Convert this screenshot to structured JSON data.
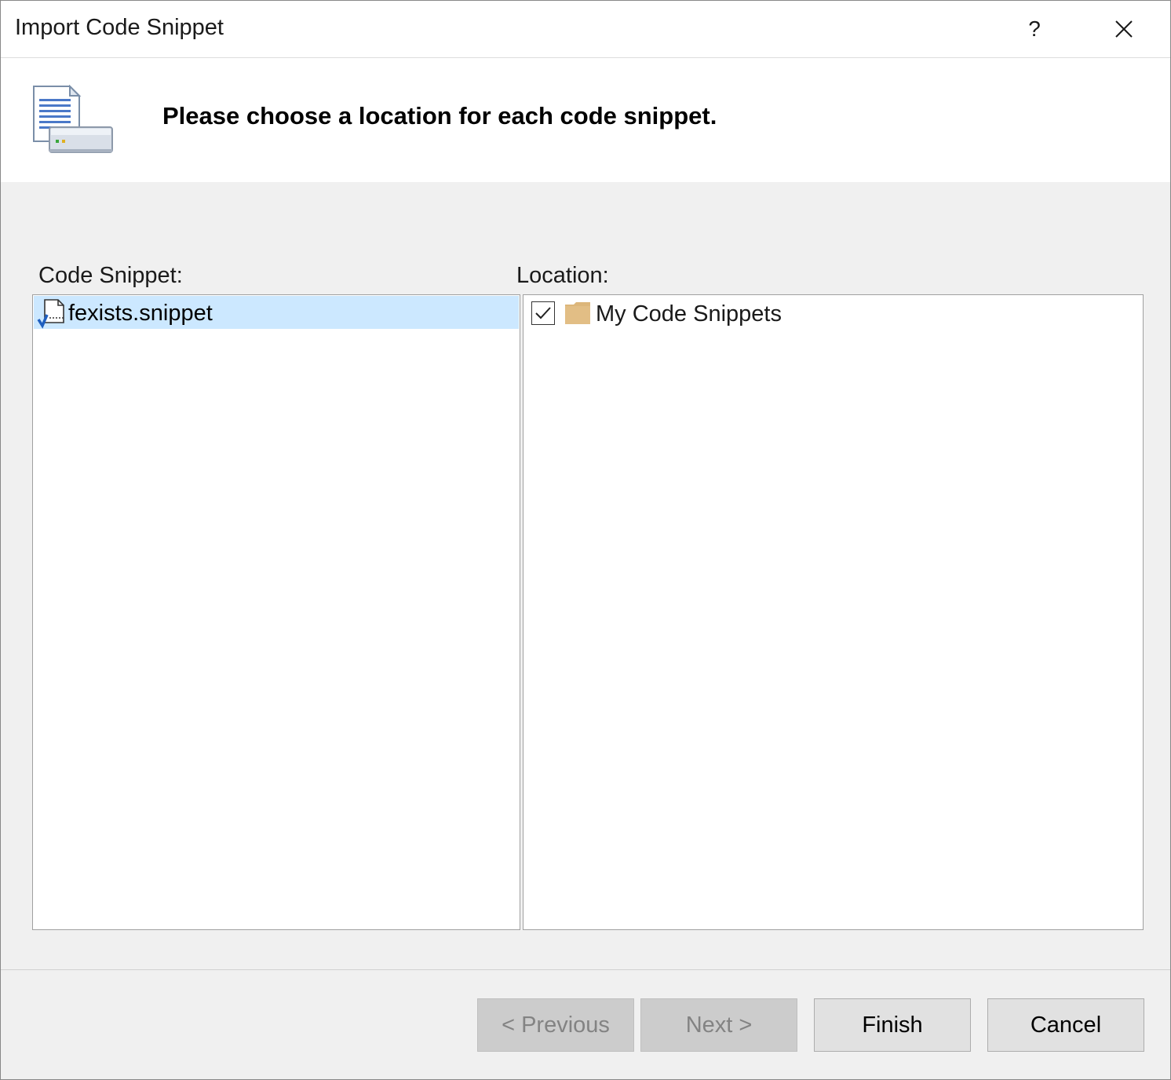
{
  "window": {
    "title": "Import Code Snippet",
    "help_label": "?"
  },
  "banner": {
    "heading": "Please choose a location for each code snippet."
  },
  "snippets": {
    "label": "Code Snippet:",
    "items": [
      {
        "name": "fexists.snippet",
        "selected": true
      }
    ]
  },
  "locations": {
    "label": "Location:",
    "items": [
      {
        "name": "My Code Snippets",
        "checked": true
      }
    ]
  },
  "buttons": {
    "previous": "< Previous",
    "next": "Next >",
    "finish": "Finish",
    "cancel": "Cancel"
  },
  "colors": {
    "selection": "#cce8ff",
    "folder": "#dcb67a"
  }
}
